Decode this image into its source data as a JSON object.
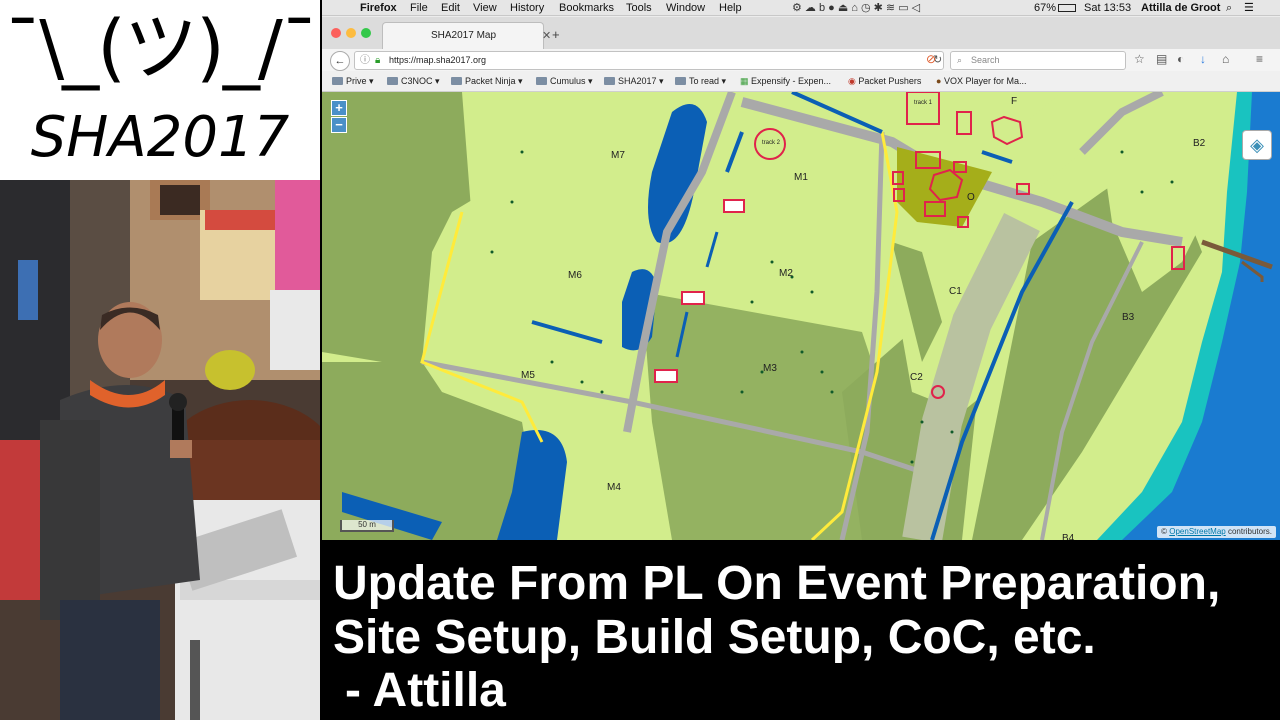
{
  "logo": {
    "shrug": "¯\\_(ツ)_/¯",
    "text": "SHA2017"
  },
  "menubar": {
    "apple_icon": "apple-icon",
    "app": "Firefox",
    "items": [
      "File",
      "Edit",
      "View",
      "History",
      "Bookmarks",
      "Tools",
      "Window",
      "Help"
    ],
    "battery": "67%",
    "clock": "Sat 13:53",
    "user": "Attilla de Groot"
  },
  "browser": {
    "tab_title": "SHA2017 Map",
    "url": "https://map.sha2017.org",
    "search_placeholder": "Search",
    "bookmarks": [
      "Prive",
      "C3NOC",
      "Packet Ninja",
      "Cumulus",
      "SHA2017",
      "To read",
      "Expensify - Expen...",
      "Packet Pushers",
      "VOX Player for Ma..."
    ]
  },
  "map": {
    "zoom_in": "+",
    "zoom_out": "−",
    "scale": "50 m",
    "attribution_prefix": "©",
    "attribution_link": "OpenStreetMap",
    "attribution_suffix": "contributors.",
    "labels": [
      "M7",
      "M1",
      "M6",
      "M2",
      "M5",
      "M3",
      "M4",
      "O",
      "F",
      "C1",
      "C2",
      "B2",
      "B3",
      "B4",
      "track 1",
      "track 2"
    ],
    "colors": {
      "land": "#d2ed8c",
      "forest": "#8dab5c",
      "water": "#0b5fb5",
      "sea": "#1a7bd0",
      "path": "#a9a9a9",
      "tent": "#e0234b"
    }
  },
  "caption": {
    "line1": "Update From PL On Event Preparation,",
    "line2": "Site Setup, Build Setup, CoC, etc.",
    "author": " - Attilla"
  }
}
